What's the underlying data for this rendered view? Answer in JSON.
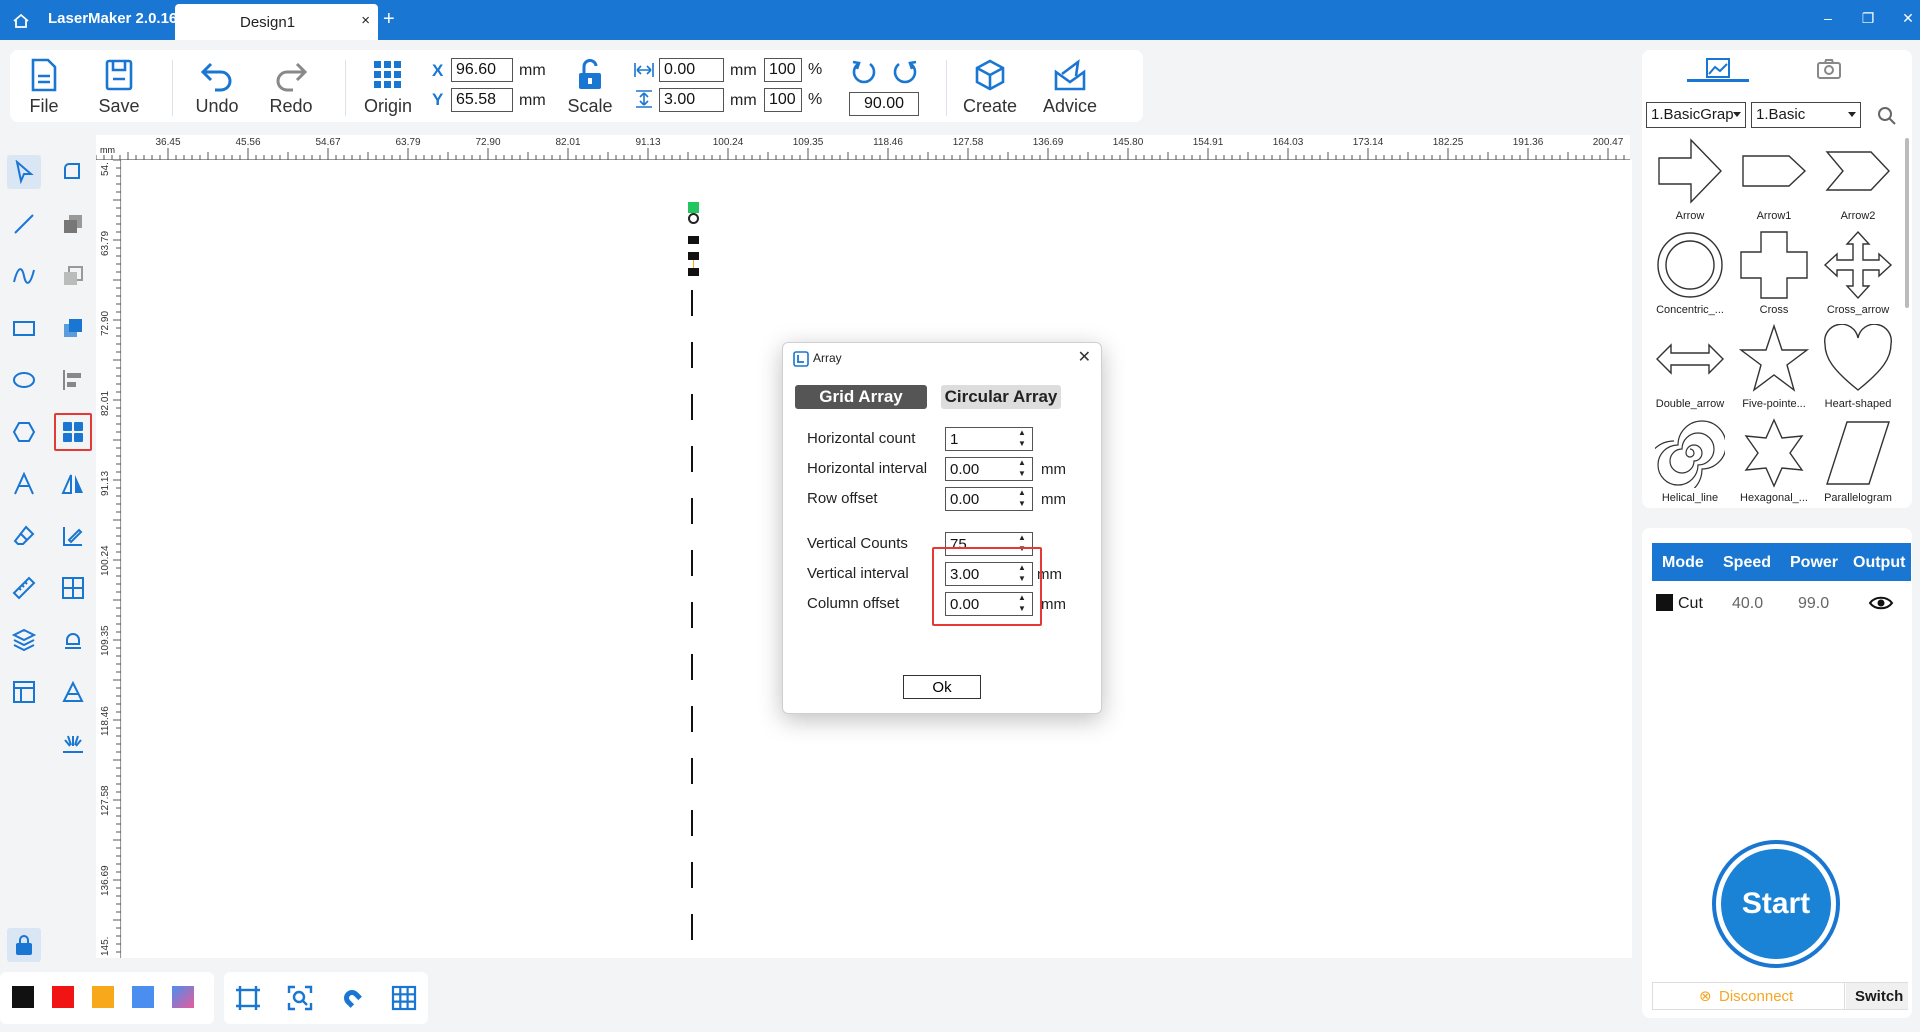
{
  "titlebar": {
    "app_name": "LaserMaker 2.0.16",
    "tab_name": "Design1",
    "tab_close": "×",
    "new_tab": "+",
    "minimize": "–",
    "maximize": "❐",
    "close": "✕"
  },
  "toolbar": {
    "file": "File",
    "save": "Save",
    "undo": "Undo",
    "redo": "Redo",
    "origin": "Origin",
    "x_label": "X",
    "x_value": "96.60",
    "y_label": "Y",
    "y_value": "65.58",
    "unit_mm": "mm",
    "scale": "Scale",
    "width_value": "0.00",
    "height_value": "3.00",
    "width_percent": "100",
    "height_percent": "100",
    "percent": "%",
    "rotation_value": "90.00",
    "create": "Create",
    "advice": "Advice"
  },
  "ruler": {
    "top": [
      "36.45",
      "45.56",
      "54.67",
      "63.79",
      "72.90",
      "82.01",
      "91.13",
      "100.24",
      "109.35",
      "118.46",
      "127.58",
      "136.69",
      "145.80",
      "154.91",
      "164.03",
      "173.14",
      "182.25",
      "191.36",
      "200.47"
    ],
    "left": [
      "54.",
      "63.79",
      "72.90",
      "82.01",
      "91.13",
      "100.24",
      "109.35",
      "118.46",
      "127.58",
      "136.69",
      "145."
    ],
    "unit": "mm"
  },
  "shapes_panel": {
    "category": "1.BasicGrap",
    "subcategory": "1.Basic",
    "items": [
      "Arrow",
      "Arrow1",
      "Arrow2",
      "Concentric_...",
      "Cross",
      "Cross_arrow",
      "Double_arrow",
      "Five-pointe...",
      "Heart-shaped",
      "Helical_line",
      "Hexagonal_...",
      "Parallelogram"
    ]
  },
  "layer_panel": {
    "headers": [
      "Mode",
      "Speed",
      "Power",
      "Output"
    ],
    "rows": [
      {
        "color": "#111111",
        "mode": "Cut",
        "speed": "40.0",
        "power": "99.0"
      }
    ]
  },
  "start_button": "Start",
  "connection": {
    "status": "Disconnect",
    "switch": "Switch"
  },
  "dialog": {
    "title": "Array",
    "tabs": [
      "Grid Array",
      "Circular Array"
    ],
    "fields": [
      {
        "label": "Horizontal count",
        "value": "1",
        "unit": ""
      },
      {
        "label": "Horizontal interval",
        "value": "0.00",
        "unit": "mm"
      },
      {
        "label": "Row offset",
        "value": "0.00",
        "unit": "mm"
      },
      {
        "label": "Vertical Counts",
        "value": "75",
        "unit": ""
      },
      {
        "label": "Vertical interval",
        "value": "3.00",
        "unit": "mm"
      },
      {
        "label": "Column offset",
        "value": "0.00",
        "unit": "mm"
      }
    ],
    "ok": "Ok"
  },
  "colors": {
    "accent": "#1976d2",
    "swatches": [
      "#111111",
      "#f01414",
      "#f7a81b",
      "#4a8ff0",
      "#e85a9a"
    ]
  }
}
